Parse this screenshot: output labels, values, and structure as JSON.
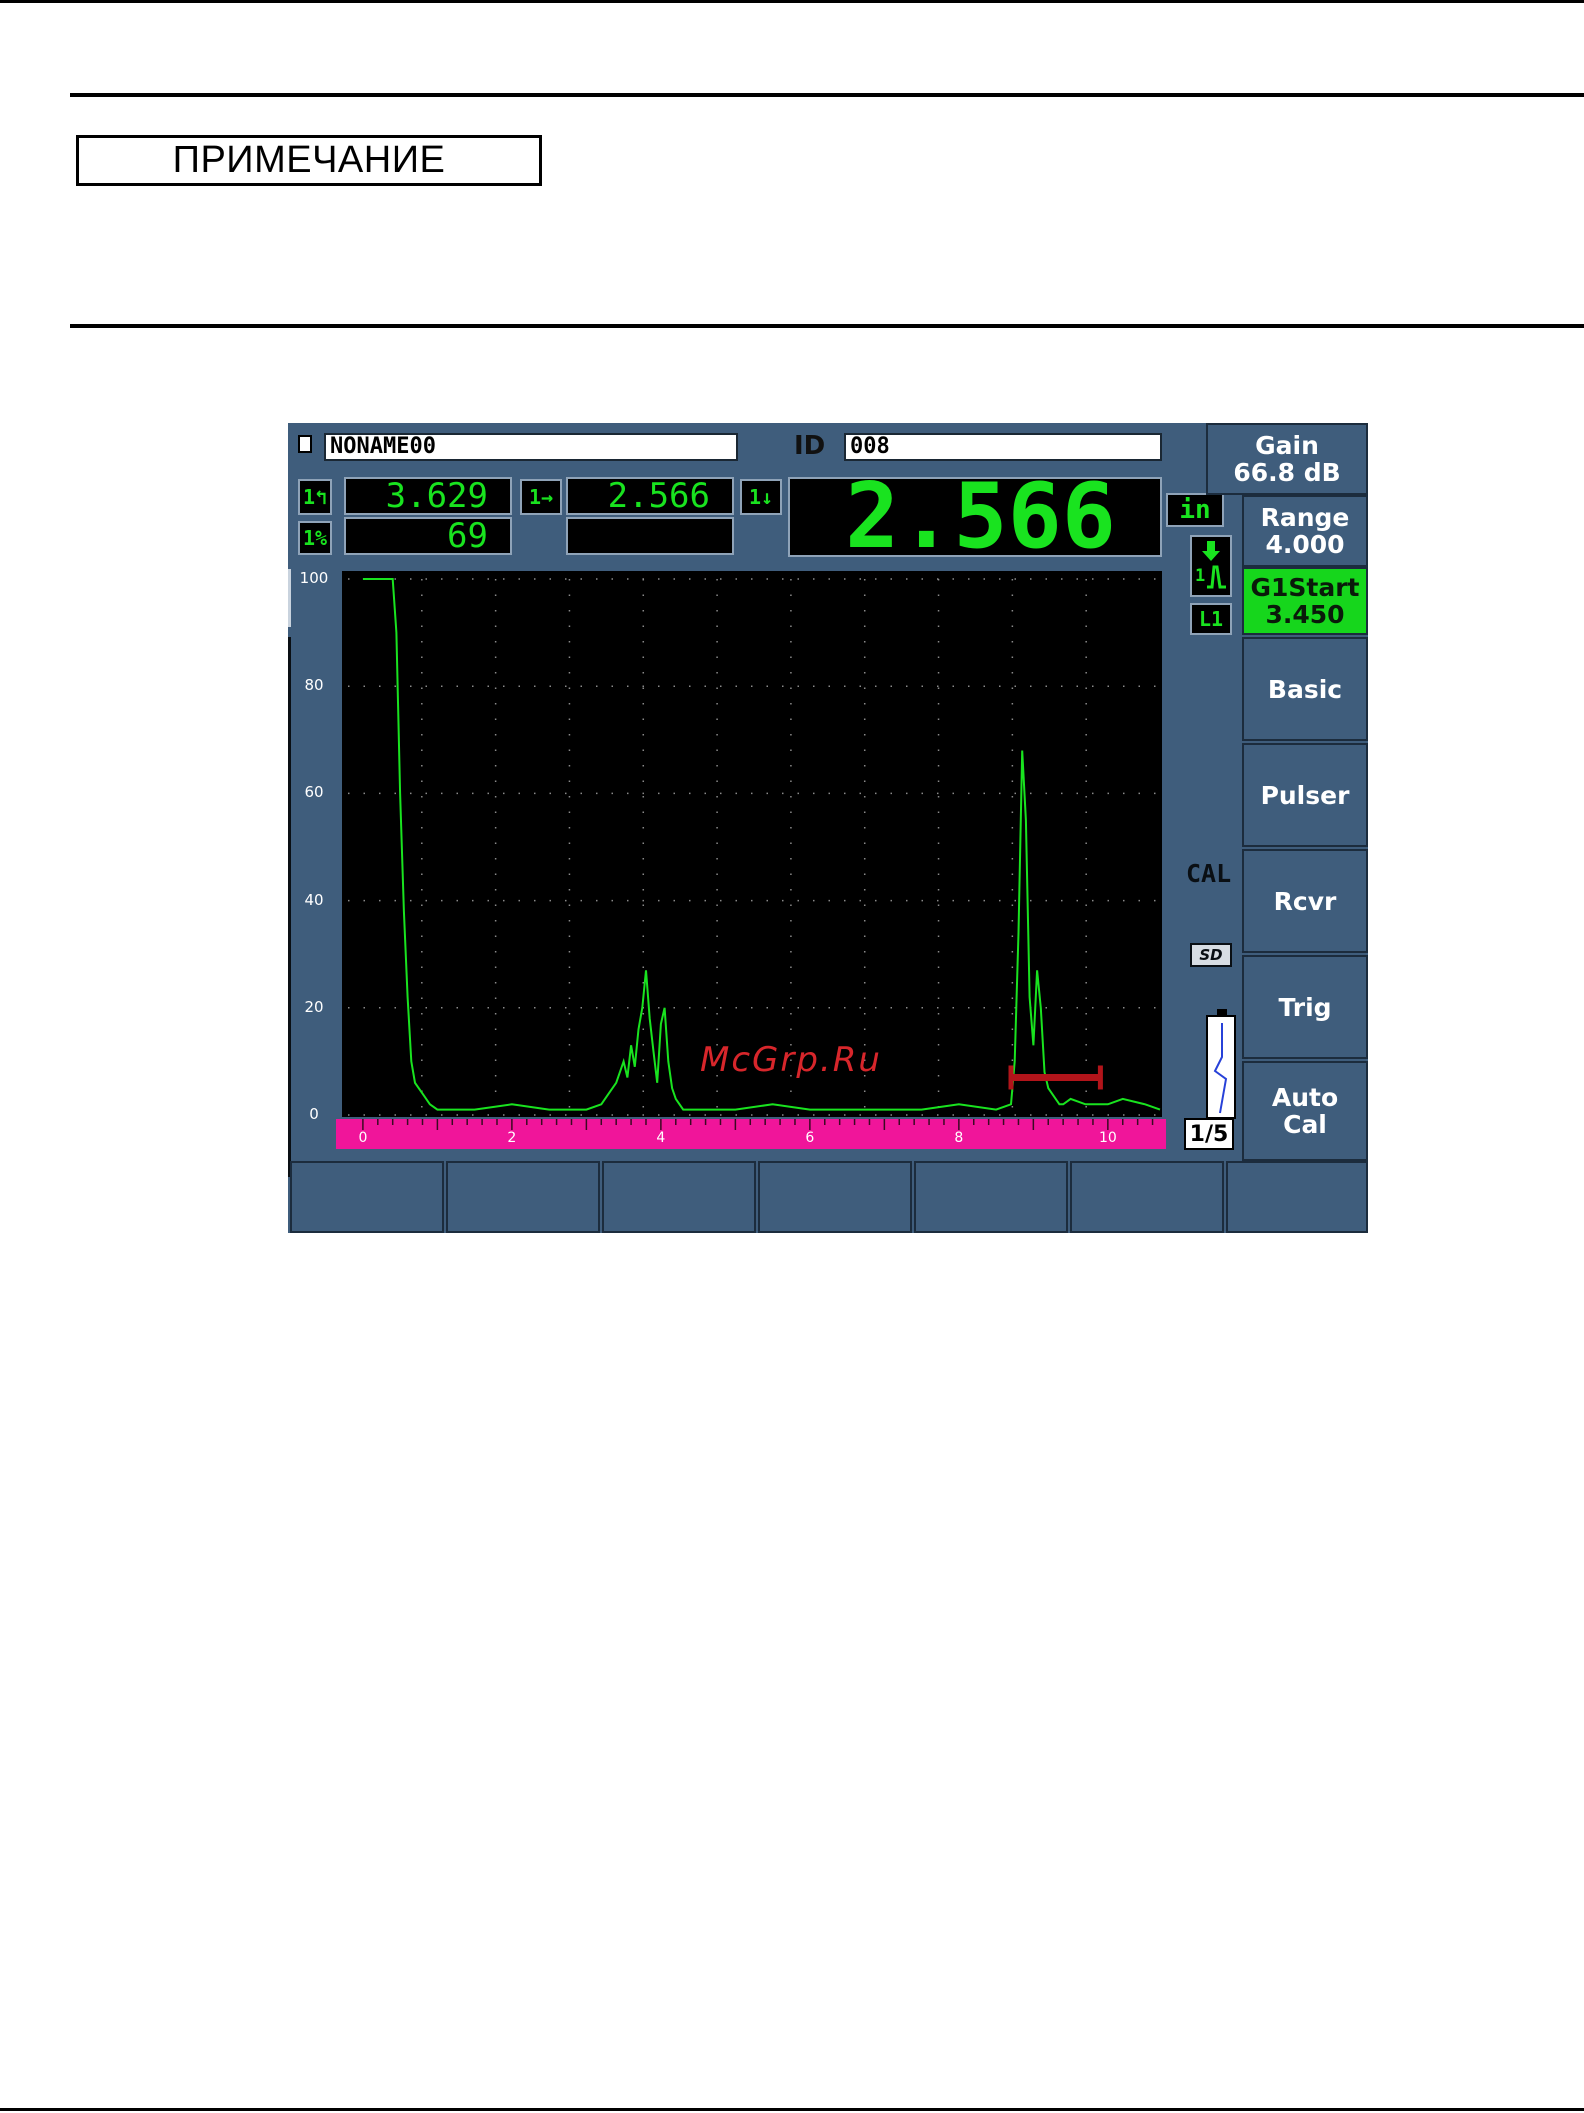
{
  "note": {
    "label": "ПРИМЕЧАНИЕ"
  },
  "screen": {
    "file_name": "NONAME00",
    "id_label": "ID",
    "id_value": "008",
    "readings": {
      "r1_icon": "1↰",
      "r1_value": "3.629",
      "r2_icon": "1%",
      "r2_value": "69",
      "r3_icon": "1→",
      "r3_value": "2.566",
      "r4_icon": "1↓",
      "big_value": "2.566",
      "unit": "in"
    },
    "status": {
      "cal": "CAL",
      "sd": "SD",
      "page": "1/5",
      "l1": "L1"
    },
    "side_buttons": [
      {
        "line1": "Gain",
        "line2": "66.8 dB"
      },
      {
        "line1": "Range",
        "line2": "4.000"
      },
      {
        "line1": "G1Start",
        "line2": "3.450"
      },
      {
        "line1": "Basic",
        "line2": ""
      },
      {
        "line1": "Pulser",
        "line2": ""
      },
      {
        "line1": "Rcvr",
        "line2": ""
      },
      {
        "line1": "Trig",
        "line2": ""
      },
      {
        "line1": "Auto",
        "line2": "Cal"
      }
    ],
    "colors": {
      "signal": "#19e31f",
      "ruler": "#f0159a",
      "gate": "#b2141a",
      "active_button": "#16d61c"
    }
  },
  "watermark": "McGrp.Ru",
  "chart_data": {
    "type": "line",
    "title": "",
    "xlabel": "",
    "ylabel": "",
    "xlim": [
      -0.2,
      10.7
    ],
    "ylim": [
      0,
      100
    ],
    "y_ticks": [
      "100",
      "80",
      "60",
      "40",
      "20",
      "0"
    ],
    "x_ticks": [
      "0",
      "2",
      "4",
      "6",
      "8",
      "10"
    ],
    "gate": {
      "start": 8.7,
      "end": 9.9,
      "level": 7
    },
    "series": [
      {
        "x": [
          0.0,
          0.05,
          0.1,
          0.2,
          0.3,
          0.35,
          0.4,
          0.45,
          0.5,
          0.55,
          0.6,
          0.65,
          0.7,
          0.8,
          0.9,
          1.0,
          1.2,
          1.5,
          2.0,
          2.5,
          3.0,
          3.2,
          3.3,
          3.4,
          3.5,
          3.55,
          3.6,
          3.65,
          3.7,
          3.75,
          3.8,
          3.85,
          3.9,
          3.95,
          4.0,
          4.05,
          4.1,
          4.15,
          4.2,
          4.3,
          4.5,
          5.0,
          5.5,
          6.0,
          6.5,
          7.0,
          7.5,
          8.0,
          8.5,
          8.7,
          8.75,
          8.8,
          8.85,
          8.9,
          8.95,
          9.0,
          9.05,
          9.1,
          9.15,
          9.2,
          9.25,
          9.3,
          9.35,
          9.4,
          9.5,
          9.7,
          10.0,
          10.2,
          10.5,
          10.7
        ],
        "y": [
          100,
          100,
          100,
          100,
          100,
          100,
          100,
          90,
          60,
          38,
          22,
          10,
          6,
          4,
          2,
          1,
          1,
          1,
          2,
          1,
          1,
          2,
          4,
          6,
          10,
          7,
          13,
          9,
          16,
          20,
          27,
          18,
          12,
          6,
          17,
          20,
          10,
          5,
          3,
          1,
          1,
          1,
          2,
          1,
          1,
          1,
          1,
          2,
          1,
          2,
          10,
          34,
          68,
          55,
          22,
          13,
          27,
          20,
          8,
          5,
          4,
          3,
          2,
          2,
          3,
          2,
          2,
          3,
          2,
          1
        ]
      }
    ]
  }
}
